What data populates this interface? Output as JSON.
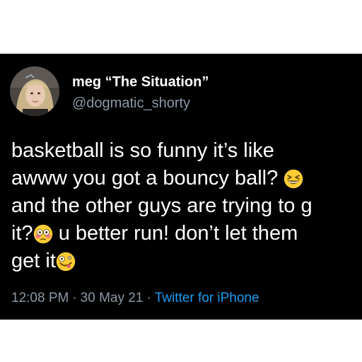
{
  "tweet": {
    "display_name": "meg “The Situation”",
    "handle": "@dogmatic_shorty",
    "lines": [
      {
        "text": "basketball is so funny it’s like",
        "emoji_after": null
      },
      {
        "text": "awww you got a bouncy ball? ",
        "emoji_after": "grinning-squinting-face"
      },
      {
        "text": "and the other guys are trying to g",
        "emoji_after": null
      },
      {
        "text": "it?",
        "emoji_after": "flushed-face",
        "text_after": " u better run! don’t let them"
      },
      {
        "text": "get it",
        "emoji_after": "zany-face"
      }
    ],
    "time": "12:08 PM",
    "separator": "·",
    "date": "30 May 21",
    "source": "Twitter for iPhone"
  },
  "colors": {
    "background": "#000000",
    "text": "#ffffff",
    "secondary": "#8b98a5",
    "link": "#1d9bf0",
    "emoji_face": "#ffcc33"
  }
}
